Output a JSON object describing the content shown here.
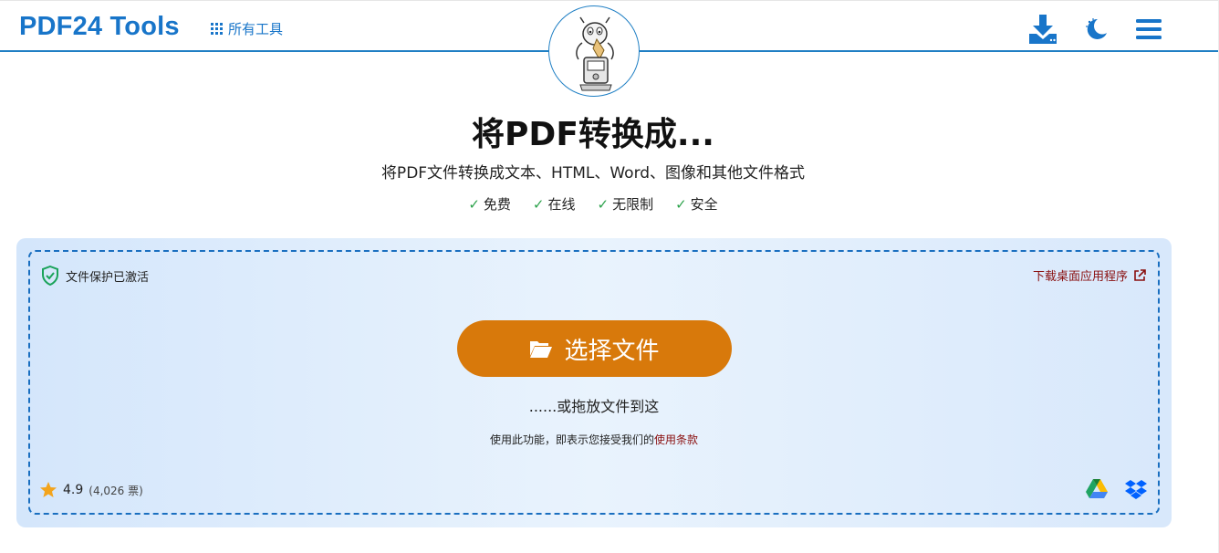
{
  "header": {
    "logo": "PDF24 Tools",
    "all_tools": "所有工具",
    "icons": [
      "download-icon",
      "dark-mode-icon",
      "menu-icon"
    ]
  },
  "hero": {
    "title": "将PDF转换成...",
    "subtitle": "将PDF文件转换成文本、HTML、Word、图像和其他文件格式",
    "features": [
      "免费",
      "在线",
      "无限制",
      "安全"
    ]
  },
  "upload": {
    "protection_label": "文件保护已激活",
    "desktop_link": "下载桌面应用程序",
    "choose_button": "选择文件",
    "drop_text": "......或拖放文件到这",
    "terms_prefix": "使用此功能，即表示您接受我们的",
    "terms_link": "使用条款",
    "rating": "4.9",
    "votes": "(4,026 票)",
    "cloud_sources": [
      "google-drive-icon",
      "dropbox-icon"
    ]
  },
  "colors": {
    "brand_blue": "#1875c9",
    "button_orange": "#d8790b",
    "link_red": "#8a1010",
    "check_green": "#2ca24b",
    "star": "#f3a41c"
  }
}
